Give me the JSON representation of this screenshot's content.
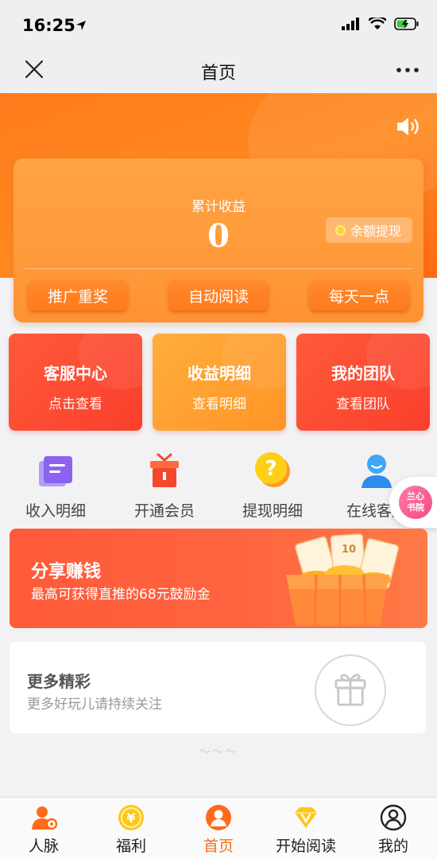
{
  "status_bar": {
    "time": "16:25"
  },
  "nav": {
    "title": "首页"
  },
  "earnings": {
    "label": "累计收益",
    "value": "0",
    "withdraw_label": "余额提现",
    "actions": [
      "推广重奖",
      "自动阅读",
      "每天一点"
    ]
  },
  "feature_cards": [
    {
      "title": "客服中心",
      "subtitle": "点击查看",
      "color": "#fa4a30"
    },
    {
      "title": "收益明细",
      "subtitle": "查看明细",
      "color": "#ffa033"
    },
    {
      "title": "我的团队",
      "subtitle": "查看团队",
      "color": "#fa4a30"
    }
  ],
  "icon_grid": [
    {
      "label": "收入明细",
      "icon": "document-icon"
    },
    {
      "label": "开通会员",
      "icon": "gift-box-icon"
    },
    {
      "label": "提现明细",
      "icon": "question-icon"
    },
    {
      "label": "在线客服",
      "icon": "person-icon"
    }
  ],
  "floating_badge": {
    "text_line1": "兰心",
    "text_line2": "书院"
  },
  "share_banner": {
    "title": "分享赚钱",
    "subtitle": "最高可获得直推的68元鼓励金",
    "ticket_label": "10"
  },
  "more_card": {
    "title": "更多精彩",
    "subtitle": "更多好玩儿请持续关注"
  },
  "end_mark": "～～～",
  "tab_bar": {
    "active_index": 2,
    "active_color": "#ff6a1a",
    "tabs": [
      {
        "label": "人脉",
        "icon": "people-icon"
      },
      {
        "label": "福利",
        "icon": "coin-icon"
      },
      {
        "label": "首页",
        "icon": "home-icon"
      },
      {
        "label": "开始阅读",
        "icon": "diamond-icon"
      },
      {
        "label": "我的",
        "icon": "profile-icon"
      }
    ]
  }
}
